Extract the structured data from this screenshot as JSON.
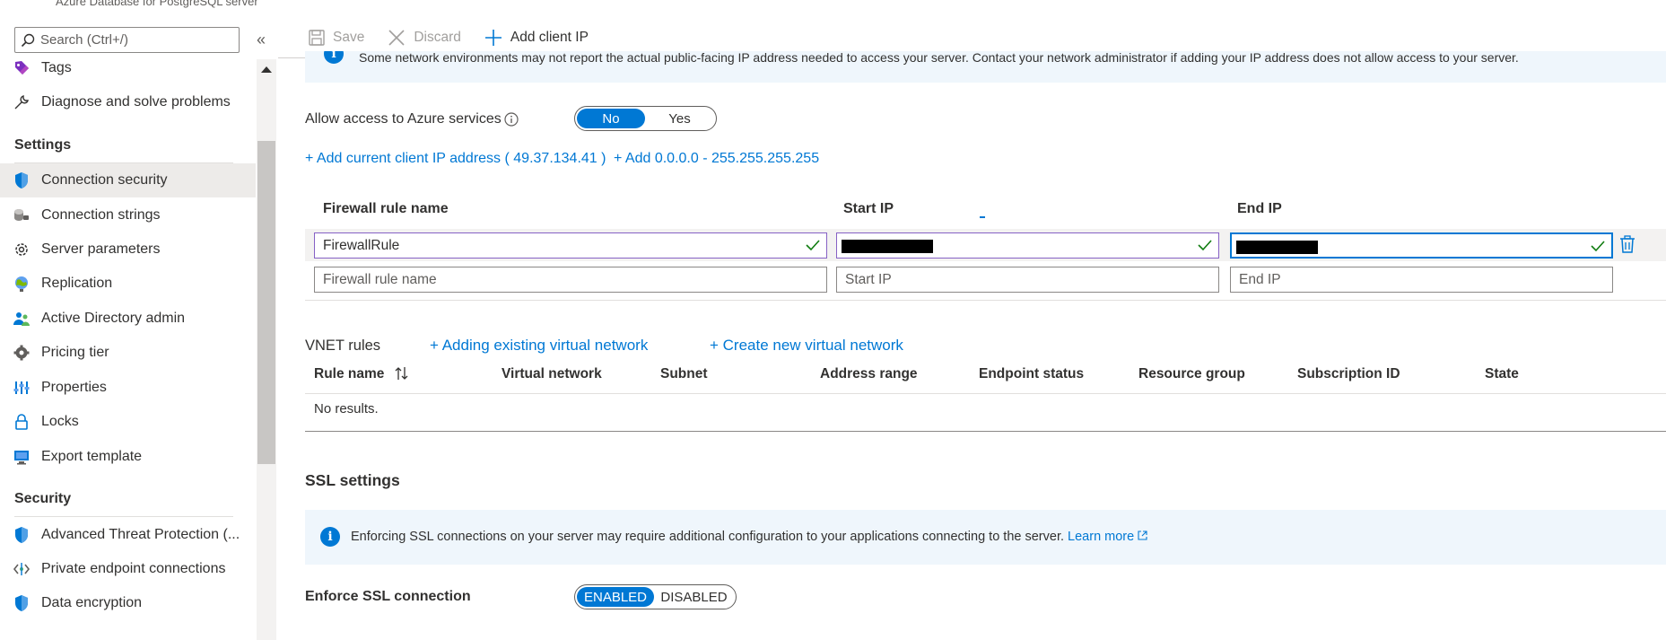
{
  "resource_subtitle": "Azure Database for PostgreSQL server",
  "search": {
    "placeholder": "Search (Ctrl+/)"
  },
  "nav": {
    "top_items": [
      {
        "label": "Tags",
        "icon": "tag-icon"
      },
      {
        "label": "Diagnose and solve problems",
        "icon": "wrench-icon"
      }
    ],
    "settings_header": "Settings",
    "settings_items": [
      {
        "label": "Connection security",
        "icon": "shield-icon",
        "selected": true
      },
      {
        "label": "Connection strings",
        "icon": "plug-icon"
      },
      {
        "label": "Server parameters",
        "icon": "gear-icon"
      },
      {
        "label": "Replication",
        "icon": "globe-icon"
      },
      {
        "label": "Active Directory admin",
        "icon": "users-icon"
      },
      {
        "label": "Pricing tier",
        "icon": "cog-icon"
      },
      {
        "label": "Properties",
        "icon": "sliders-icon"
      },
      {
        "label": "Locks",
        "icon": "lock-icon"
      },
      {
        "label": "Export template",
        "icon": "export-icon"
      }
    ],
    "security_header": "Security",
    "security_items": [
      {
        "label": "Advanced Threat Protection (...",
        "icon": "shield-icon"
      },
      {
        "label": "Private endpoint connections",
        "icon": "endpoint-icon"
      },
      {
        "label": "Data encryption",
        "icon": "shield-icon"
      }
    ]
  },
  "toolbar": {
    "save_label": "Save",
    "discard_label": "Discard",
    "add_client_ip_label": "Add client IP"
  },
  "top_info": "Some network environments may not report the actual public-facing IP address needed to access your server.  Contact your network administrator if adding your IP address does not allow access to your server.",
  "allow_azure": {
    "label": "Allow access to Azure services",
    "options": [
      "No",
      "Yes"
    ],
    "selected": "No"
  },
  "links": {
    "add_current_client": "+ Add current client IP address ( 49.37.134.41 )",
    "add_range": "+ Add 0.0.0.0 - 255.255.255.255"
  },
  "firewall": {
    "headers": {
      "name": "Firewall rule name",
      "start": "Start IP",
      "end": "End IP"
    },
    "rows": [
      {
        "name": "FirewallRule",
        "start": "",
        "end": ""
      }
    ],
    "new_row_placeholders": {
      "name": "Firewall rule name",
      "start": "Start IP",
      "end": "End IP"
    },
    "delete_icon": "trash-icon"
  },
  "vnet": {
    "title": "VNET rules",
    "add_existing": "+ Adding existing virtual network",
    "create_new": "+ Create new virtual network",
    "columns": [
      "Rule name",
      "Virtual network",
      "Subnet",
      "Address range",
      "Endpoint status",
      "Resource group",
      "Subscription ID",
      "State"
    ],
    "empty_text": "No results."
  },
  "ssl": {
    "title": "SSL settings",
    "info_text": "Enforcing SSL connections on your server may require additional configuration to your applications connecting to the server.",
    "learn_more": "Learn more",
    "enforce_label": "Enforce SSL connection",
    "options": [
      "ENABLED",
      "DISABLED"
    ],
    "selected": "ENABLED"
  },
  "colors": {
    "accent": "#0078d4",
    "valid_border": "#8661c5",
    "check": "#107c10"
  }
}
